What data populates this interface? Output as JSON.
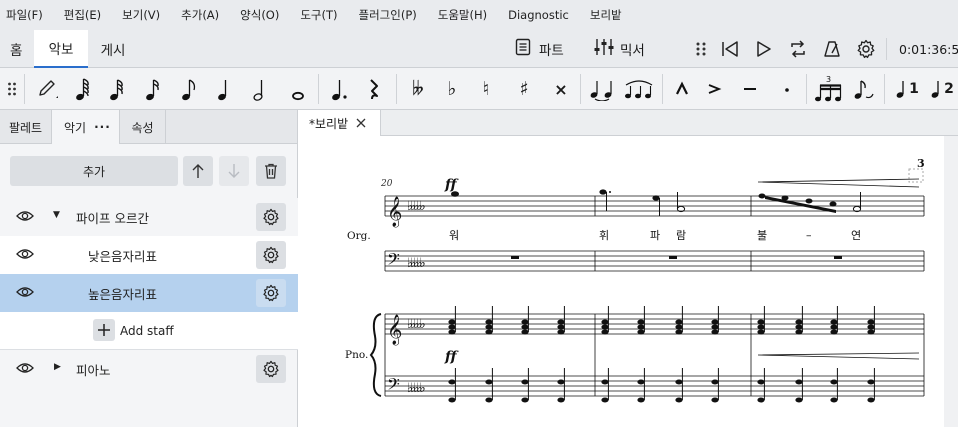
{
  "menu": [
    "파일(F)",
    "편집(E)",
    "보기(V)",
    "추가(A)",
    "양식(O)",
    "도구(T)",
    "플러그인(P)",
    "도움말(H)",
    "Diagnostic",
    "보리밭"
  ],
  "workspace_tabs": [
    "홈",
    "악보",
    "게시"
  ],
  "toolbar": {
    "parts_label": "파트",
    "mixer_label": "믹서",
    "time": "0:01:36:5"
  },
  "note_toolbar": {
    "tuplet_number": "3",
    "voice1": "1",
    "voice2": "2"
  },
  "panel_tabs": [
    "팔레트",
    "악기",
    "속성"
  ],
  "panel_tab_more": "···",
  "instruments": {
    "add_label": "추가",
    "add_staff_label": "Add staff",
    "items": [
      {
        "label": "파이프 오르간",
        "expanded": true
      },
      {
        "label": "낮은음자리표"
      },
      {
        "label": "높은음자리표",
        "selected": true
      },
      {
        "label": "피아노",
        "expanded": false
      }
    ]
  },
  "score_tab": {
    "title": "*보리밭"
  },
  "score": {
    "measure_number": "20",
    "dynamic": "ff",
    "instrument_org": "Org.",
    "instrument_pno": "Pno.",
    "lyrics": [
      "워",
      "휘",
      "파",
      "람",
      "불",
      "–",
      "연"
    ],
    "tuplet_marker": "3",
    "key_flats": 5
  }
}
